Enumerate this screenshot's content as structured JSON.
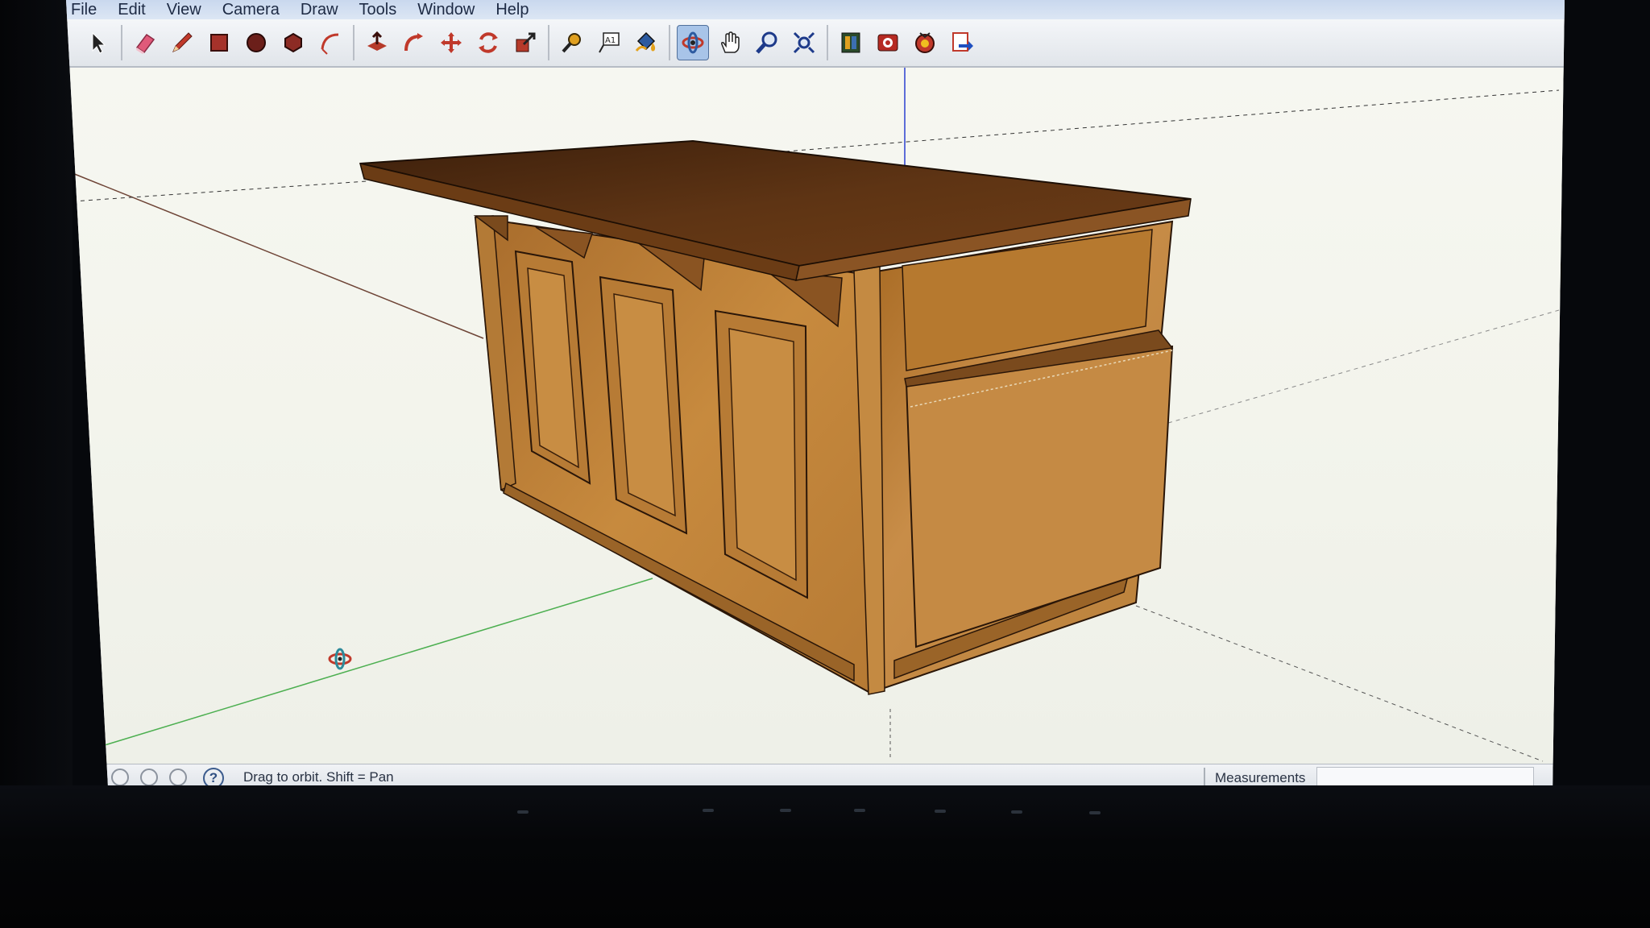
{
  "menu": {
    "items": [
      "File",
      "Edit",
      "View",
      "Camera",
      "Draw",
      "Tools",
      "Window",
      "Help"
    ]
  },
  "toolbar": {
    "tools": [
      {
        "icon": "select-arrow-icon"
      },
      {
        "icon": "eraser-icon"
      },
      {
        "icon": "pencil-line-icon"
      },
      {
        "icon": "rectangle-icon"
      },
      {
        "icon": "circle-icon"
      },
      {
        "icon": "polygon-icon"
      },
      {
        "icon": "arc-icon"
      },
      {
        "icon": "push-pull-icon"
      },
      {
        "icon": "follow-me-icon"
      },
      {
        "icon": "move-icon"
      },
      {
        "icon": "rotate-icon"
      },
      {
        "icon": "scale-icon"
      },
      {
        "icon": "tape-measure-icon"
      },
      {
        "icon": "text-label-icon"
      },
      {
        "icon": "paint-bucket-icon"
      },
      {
        "icon": "orbit-icon",
        "active": true
      },
      {
        "icon": "pan-hand-icon"
      },
      {
        "icon": "zoom-icon"
      },
      {
        "icon": "zoom-extents-icon"
      },
      {
        "icon": "get-models-icon"
      },
      {
        "icon": "share-model-icon"
      },
      {
        "icon": "components-icon"
      },
      {
        "icon": "send-to-layout-icon"
      }
    ],
    "text_tool_label": "A1"
  },
  "status": {
    "hint": "Drag to orbit.  Shift = Pan",
    "help_glyph": "?",
    "measurements_label": "Measurements",
    "measurements_value": ""
  },
  "colors": {
    "accent": "#51709b",
    "wood_light": "#c8893a",
    "wood_dark": "#7a4a1d",
    "countertop": "#5a3214",
    "axis_green": "#4caf50",
    "axis_blue": "#2a3fd0",
    "axis_red": "#7a3a2a"
  }
}
